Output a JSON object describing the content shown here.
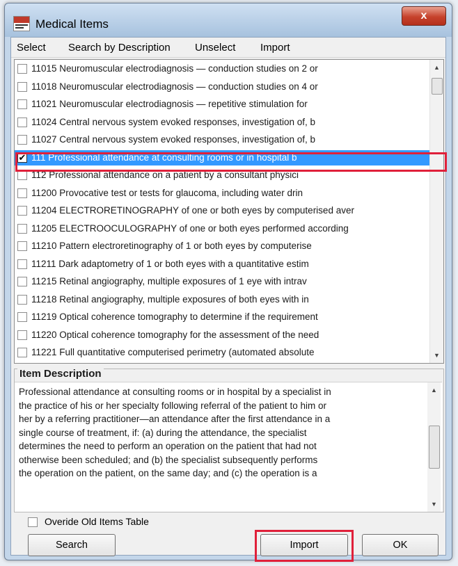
{
  "window": {
    "title": "Medical Items",
    "close_label": "x"
  },
  "menu": {
    "items": [
      "Select",
      "Search by Description",
      "Unselect",
      "Import"
    ]
  },
  "list": {
    "items": [
      {
        "checked": false,
        "text": "11015 Neuromuscular electrodiagnosis — conduction studies on 2 or"
      },
      {
        "checked": false,
        "text": "11018 Neuromuscular electrodiagnosis — conduction studies on 4 or"
      },
      {
        "checked": false,
        "text": "11021 Neuromuscular electrodiagnosis — repetitive stimulation for"
      },
      {
        "checked": false,
        "text": "11024 Central nervous system evoked responses, investigation of, b"
      },
      {
        "checked": false,
        "text": "11027 Central nervous system evoked responses, investigation of, b"
      },
      {
        "checked": true,
        "text": "111 Professional attendance at consulting rooms or in hospital b"
      },
      {
        "checked": false,
        "text": "112 Professional attendance on a patient by a consultant physici"
      },
      {
        "checked": false,
        "text": "11200 Provocative test or tests for glaucoma, including water drin"
      },
      {
        "checked": false,
        "text": "11204 ELECTRORETINOGRAPHY of one or both eyes by computerised aver"
      },
      {
        "checked": false,
        "text": "11205 ELECTROOCULOGRAPHY of one or both eyes performed according"
      },
      {
        "checked": false,
        "text": "11210 Pattern electroretinography of 1 or both eyes by computerise"
      },
      {
        "checked": false,
        "text": "11211 Dark adaptometry of 1 or both eyes with a quantitative estim"
      },
      {
        "checked": false,
        "text": "11215 Retinal angiography, multiple exposures of 1 eye with intrav"
      },
      {
        "checked": false,
        "text": "11218 Retinal angiography, multiple exposures of both eyes with in"
      },
      {
        "checked": false,
        "text": "11219 Optical coherence tomography to determine if the requirement"
      },
      {
        "checked": false,
        "text": "11220 Optical coherence tomography for the assessment of the need"
      },
      {
        "checked": false,
        "text": "11221 Full quantitative computerised perimetry (automated absolute"
      }
    ],
    "selected_index": 5
  },
  "description": {
    "title": "Item Description",
    "lines": [
      "Professional attendance at consulting rooms or in hospital by a specialist in",
      "the practice of his or her specialty following referral of the patient to him or",
      "her by a referring practitioner—an attendance after the first attendance in a",
      "single course of treatment, if: (a) during the attendance, the specialist",
      "determines the need to perform an operation on the patient that had not",
      "otherwise been scheduled; and (b) the specialist subsequently performs",
      "the operation on the patient, on the same day; and (c) the operation is a"
    ]
  },
  "options": {
    "override_label": "Overide Old Items Table",
    "override_checked": false
  },
  "buttons": {
    "search": "Search",
    "import": "Import",
    "ok": "OK"
  },
  "colors": {
    "selection": "#3399ff",
    "highlight_annotation": "#e0203a"
  }
}
